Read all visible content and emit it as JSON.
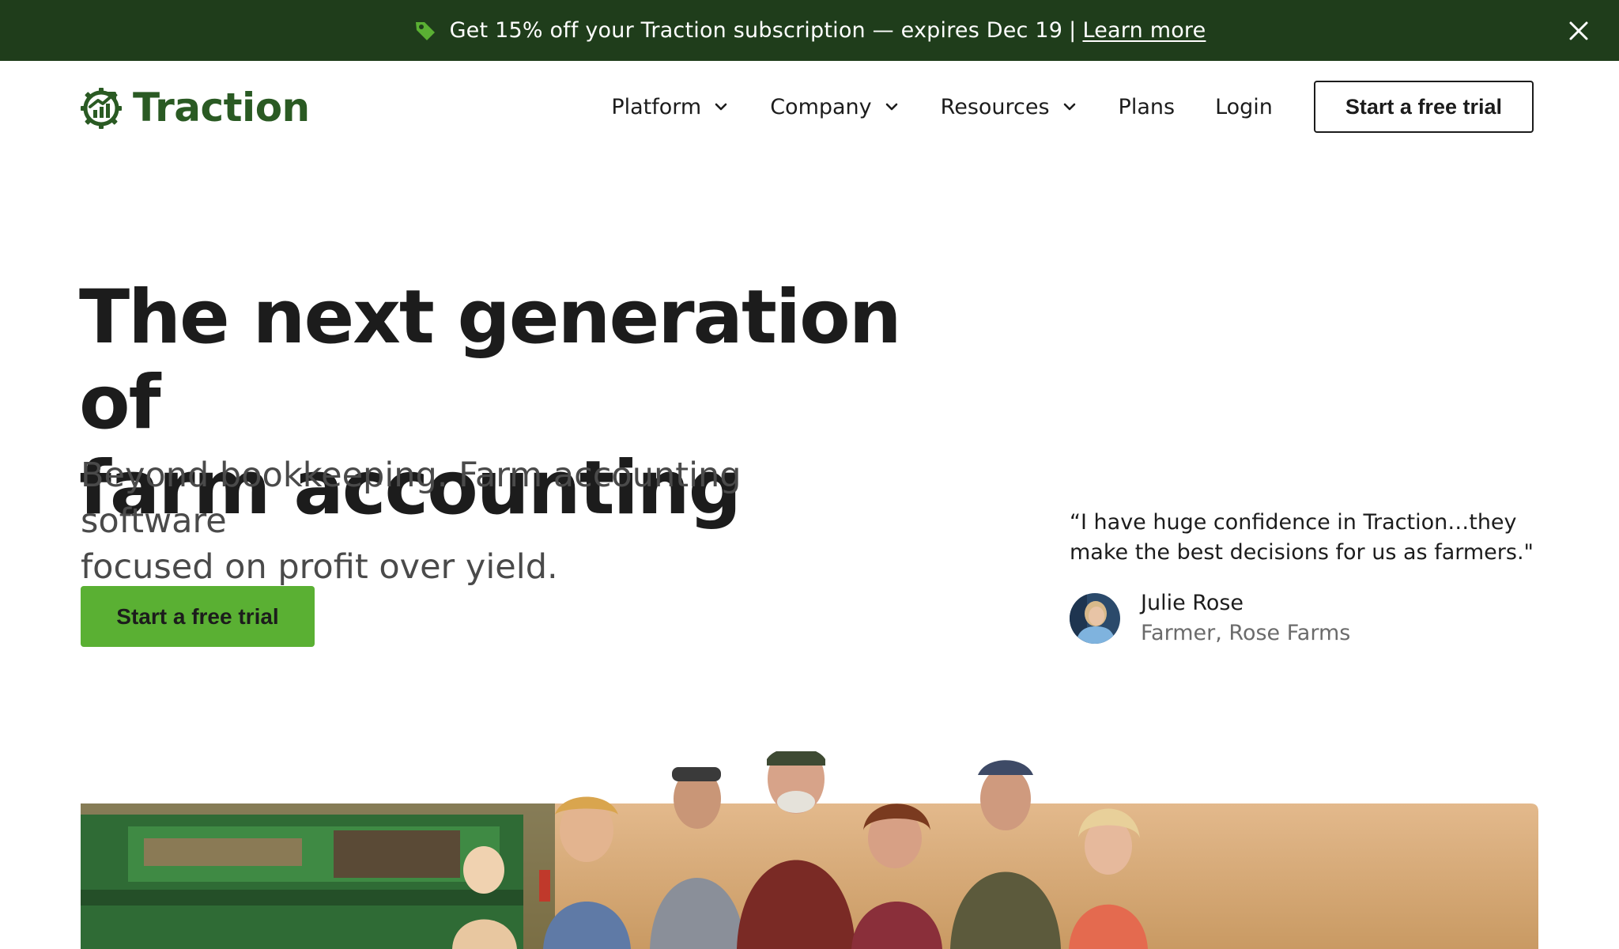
{
  "promo": {
    "text": "Get 15% off your Traction subscription — expires Dec 19",
    "separator": "|",
    "link": "Learn more",
    "tag_icon": "tag-icon",
    "close_icon": "close-icon"
  },
  "header": {
    "logo_text": "Traction",
    "logo_icon": "traction-gear-chart-icon",
    "nav": [
      {
        "label": "Platform",
        "dropdown": true
      },
      {
        "label": "Company",
        "dropdown": true
      },
      {
        "label": "Resources",
        "dropdown": true
      },
      {
        "label": "Plans",
        "dropdown": false
      },
      {
        "label": "Login",
        "dropdown": false
      }
    ],
    "cta": "Start a free trial"
  },
  "hero": {
    "title_line1": "The next generation of",
    "title_line2": "farm accounting",
    "subtitle_line1": "Beyond bookkeeping. Farm accounting software",
    "subtitle_line2": "focused on profit over yield.",
    "cta": "Start a free trial"
  },
  "testimonial": {
    "quote_line1": "“I have huge confidence in Traction…they",
    "quote_line2": "make the best decisions for us as farmers.\"",
    "name": "Julie Rose",
    "role": "Farmer, Rose Farms"
  },
  "colors": {
    "banner_bg": "#1f3d1b",
    "brand_green": "#2a5a23",
    "cta_green": "#5ab033",
    "text_dark": "#1c1c1c",
    "text_muted": "#6b6b6b"
  }
}
